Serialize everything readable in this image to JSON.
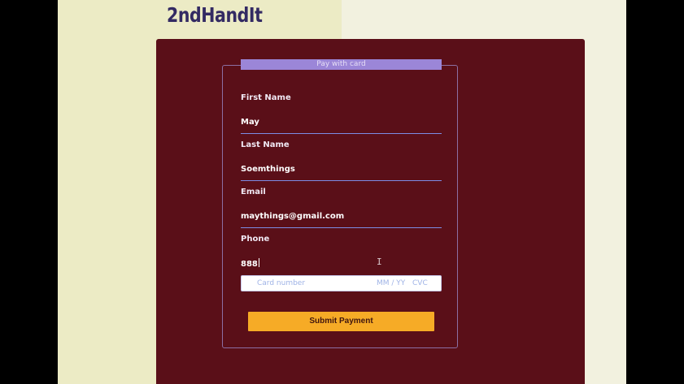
{
  "brand": {
    "logo_text": "2ndHandIt"
  },
  "form": {
    "legend": "Pay with card",
    "fields": [
      {
        "label": "First Name",
        "value": "May"
      },
      {
        "label": "Last Name",
        "value": "Soemthings"
      },
      {
        "label": "Email",
        "value": "maythings@gmail.com"
      },
      {
        "label": "Phone",
        "value": "888"
      }
    ],
    "card": {
      "number_placeholder": "Card number",
      "expiry_placeholder": "MM / YY",
      "cvc_placeholder": "CVC"
    },
    "submit_label": "Submit Payment"
  },
  "colors": {
    "page_background": "#f2f1df",
    "panel": "#5a0f18",
    "legend": "#9b86d8",
    "submit": "#f6ab26",
    "field_underline": "#7c8ce4"
  },
  "cursor": {
    "icon": "text-cursor-icon"
  }
}
